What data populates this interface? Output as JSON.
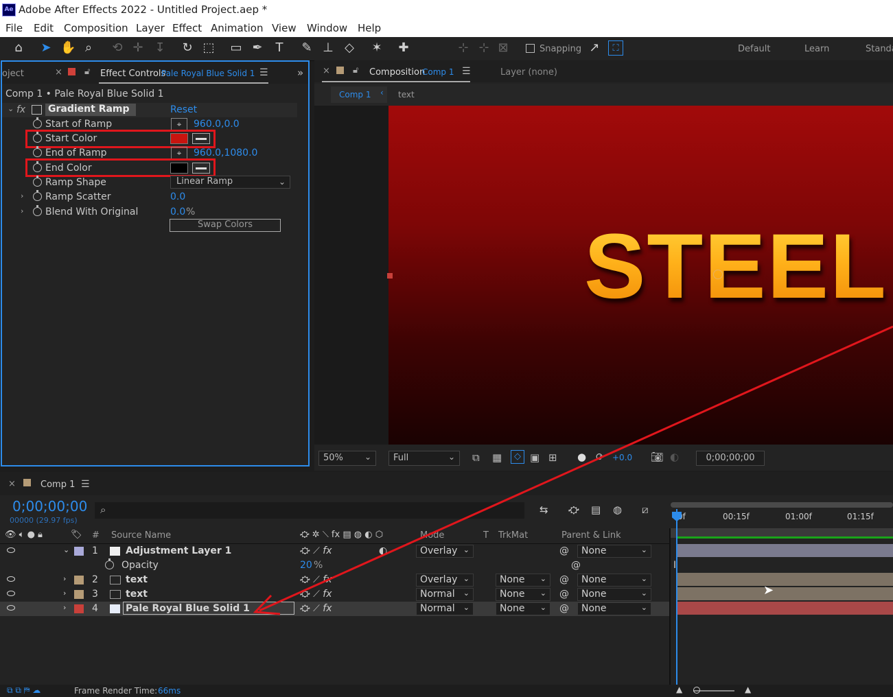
{
  "app": {
    "logo": "Ae",
    "title": "Adobe After Effects 2022 - Untitled Project.aep *"
  },
  "menu": [
    "File",
    "Edit",
    "Composition",
    "Layer",
    "Effect",
    "Animation",
    "View",
    "Window",
    "Help"
  ],
  "toolbar": {
    "snapping_label": "Snapping",
    "workspaces": [
      "Default",
      "Learn",
      "Standa"
    ]
  },
  "effect_controls": {
    "project_tab": "oject",
    "tab_label": "Effect Controls",
    "tab_layer": "Pale Royal Blue Solid 1",
    "breadcrumb": "Comp 1 • Pale Royal Blue Solid 1",
    "effect_name": "Gradient Ramp",
    "fx": "fx",
    "reset": "Reset",
    "props": {
      "start_of_ramp": {
        "label": "Start of Ramp",
        "x": "960.0",
        "y": ",0.0"
      },
      "start_color": {
        "label": "Start Color",
        "color": "#c8140f"
      },
      "end_of_ramp": {
        "label": "End of Ramp",
        "x": "960.0",
        "y": ",1080.0"
      },
      "end_color": {
        "label": "End Color",
        "color": "#000000"
      },
      "ramp_shape": {
        "label": "Ramp Shape",
        "value": "Linear Ramp"
      },
      "ramp_scatter": {
        "label": "Ramp Scatter",
        "value": "0.0"
      },
      "blend": {
        "label": "Blend With Original",
        "value": "0.0",
        "unit": "%"
      }
    },
    "swap_colors": "Swap Colors"
  },
  "composition": {
    "tab_label": "Composition",
    "tab_comp": "Comp 1",
    "layer_tab": "Layer (none)",
    "sub_tabs": [
      "Comp 1",
      "text"
    ],
    "canvas_text": "STEEL",
    "zoom": "50%",
    "resolution": "Full",
    "exposure": "+0.0",
    "timecode": "0;00;00;00"
  },
  "timeline": {
    "tab_label": "Comp 1",
    "current_time": "0;00;00;00",
    "fps_info": "00000 (29.97 fps)",
    "search_icon": "search-icon",
    "headers": {
      "num": "#",
      "source_name": "Source Name",
      "mode": "Mode",
      "t": "T",
      "trkmat": "TrkMat",
      "parent": "Parent & Link"
    },
    "ruler": [
      "0f",
      "00:15f",
      "01:00f",
      "01:15f"
    ],
    "layers": [
      {
        "num": "1",
        "name": "Adjustment Layer 1",
        "label_color": "#a9a9d9",
        "mode": "Overlay",
        "trkmat": "",
        "parent": "None",
        "bar_color": "#7a7a8e"
      },
      {
        "num": "2",
        "name": "text",
        "label_color": "#b59b76",
        "mode": "Overlay",
        "trkmat": "None",
        "parent": "None",
        "bar_color": "#7d7264"
      },
      {
        "num": "3",
        "name": "text",
        "label_color": "#b59b76",
        "mode": "Normal",
        "trkmat": "None",
        "parent": "None",
        "bar_color": "#7d7264"
      },
      {
        "num": "4",
        "name": "Pale Royal Blue Solid 1",
        "label_color": "#c8403a",
        "mode": "Normal",
        "trkmat": "None",
        "parent": "None",
        "bar_color": "#a94848"
      }
    ],
    "opacity": {
      "label": "Opacity",
      "value": "20",
      "unit": "%"
    }
  },
  "status": {
    "label": "Frame Render Time:",
    "value": "66ms"
  }
}
